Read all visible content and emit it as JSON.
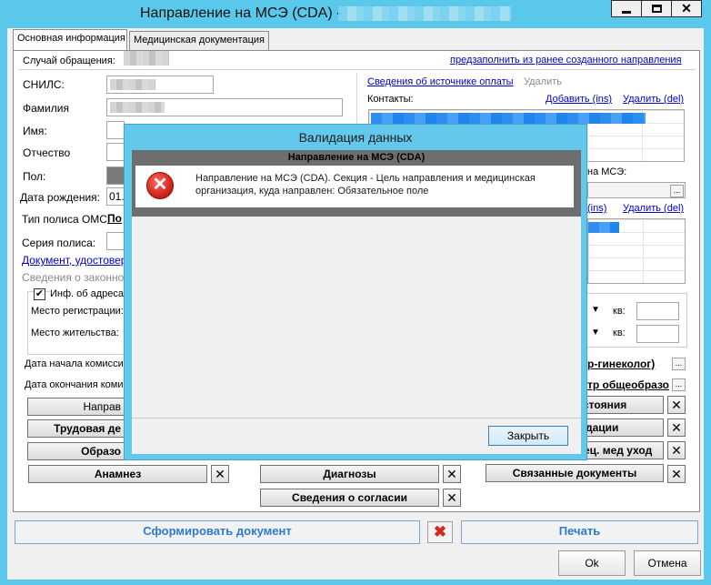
{
  "window": {
    "title": "Направление на МСЭ (CDA) -",
    "controls": [
      "minimize-icon",
      "maximize-icon",
      "close-icon"
    ]
  },
  "tabs": [
    {
      "label": "Основная информация",
      "active": true
    },
    {
      "label": "Медицинская документация",
      "active": false
    }
  ],
  "form": {
    "case_label": "Случай обращения:",
    "prefill_link": "предзаполнить из ранее созданного направления",
    "snils_label": "СНИЛС:",
    "surname_label": "Фамилия",
    "name_label": "Имя:",
    "patronymic_label": "Отчество",
    "gender_label": "Пол:",
    "birthdate_label": "Дата рождения:",
    "birthdate_value": "01.",
    "policy_type_label": "Тип полиса ОМС:",
    "policy_type_value": "По",
    "policy_series_label": "Серия полиса:",
    "doc_link": "Документ, удостовер",
    "legal_rep": "Сведения о законном",
    "address_checkbox_label": "Инф. об адреса",
    "address_checked": true,
    "registration_label": "Место регистрации:",
    "residence_label": "Место жительства:",
    "commission_start_label": "Дата начала комисси",
    "commission_end_label": "Дата окончания коми",
    "apartment_label": "кв:"
  },
  "right": {
    "payment_link": "Сведения об источнике оплаты",
    "payment_delete": "Удалить",
    "contacts_label": "Контакты:",
    "add_link": "Добавить (ins)",
    "delete_link": "Удалить (del)",
    "mse_label": "на МСЭ:",
    "ins_link_partial": "(ins)",
    "gynecologist_partial": "р-гинеколог)",
    "general_partial": "тр общеобразо"
  },
  "section_buttons": {
    "left1": "Направ",
    "left2": "Трудовая де",
    "left3": "Образо",
    "anamnesis": "Анамнез",
    "diagnoses": "Диагнозы",
    "consent": "Сведения о согласии",
    "right1": "стояния",
    "right2": "дации",
    "right3": "ец. мед уход",
    "related_docs": "Связанные документы"
  },
  "bottom": {
    "generate": "Сформировать документ",
    "print": "Печать",
    "ok": "Ok",
    "cancel": "Отмена"
  },
  "dialog": {
    "title": "Валидация данных",
    "header": "Направление на МСЭ (CDA)",
    "message": "Направление на МСЭ (CDA). Секция - Цель направления и медицинская организация, куда направлен: Обязательное поле",
    "close": "Закрыть"
  }
}
